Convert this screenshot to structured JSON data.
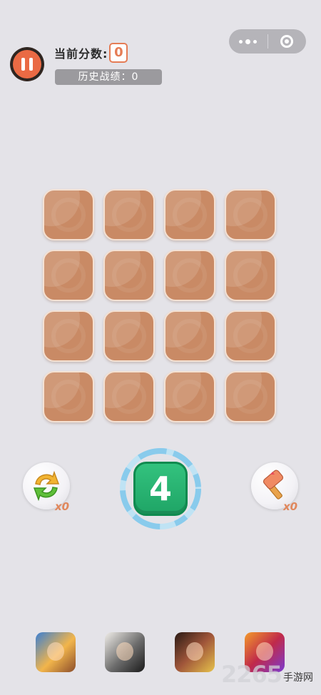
{
  "header": {
    "score_label": "当前分数:",
    "score_value": "0",
    "history_text": "历史战绩：0"
  },
  "board": {
    "rows": 4,
    "cols": 4,
    "tile_color": "#c98a65"
  },
  "next_tile": {
    "value": "4",
    "color": "#22b06c"
  },
  "tools": {
    "refresh_count": "x0",
    "hammer_count": "x0"
  },
  "ads": [
    {
      "icon": "game-icon-monkey-king"
    },
    {
      "icon": "game-icon-ink-warrior"
    },
    {
      "icon": "game-icon-warrior"
    },
    {
      "icon": "game-icon-heroine"
    }
  ],
  "watermark": {
    "big": "2265",
    "small": "手游网"
  },
  "icons": {
    "pause": "pause-icon",
    "more": "more-dots-icon",
    "close": "close-target-icon",
    "refresh": "refresh-arrows-icon",
    "hammer": "hammer-icon"
  }
}
